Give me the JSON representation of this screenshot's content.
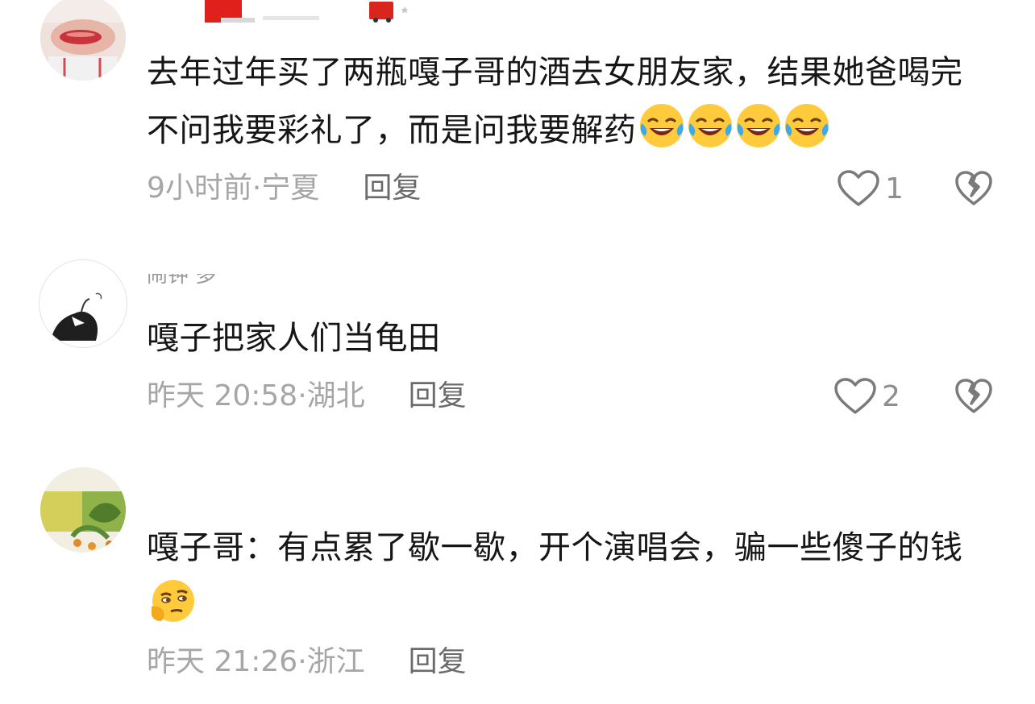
{
  "comments": [
    {
      "username": "",
      "text": "去年过年买了两瓶嘎子哥的酒去女朋友家，结果她爸喝完不问我要彩礼了，而是问我要解药",
      "emojis": [
        "laugh-cry-emoji",
        "laugh-cry-emoji",
        "laugh-cry-emoji",
        "laugh-cry-emoji"
      ],
      "time": "9小时前",
      "location": "宁夏",
      "reply_label": "回复",
      "likes": "1"
    },
    {
      "username": "闹钟  多",
      "text": "嘎子把家人们当龟田",
      "emojis": [],
      "time": "昨天 20:58",
      "location": "湖北",
      "reply_label": "回复",
      "likes": "2"
    },
    {
      "username": "",
      "text": "嘎子哥：有点累了歇一歇，开个演唱会，骗一些傻子的钱",
      "emojis": [
        "thinking-emoji"
      ],
      "time": "昨天 21:26",
      "location": "浙江",
      "reply_label": "回复",
      "likes": ""
    }
  ],
  "meta_separator": "·",
  "colors": {
    "text": "#161616",
    "meta": "#a6a6a6",
    "reply": "#6b6b6b",
    "icon": "#7a7a7a",
    "emoji_yellow": "#ffcb3d"
  }
}
